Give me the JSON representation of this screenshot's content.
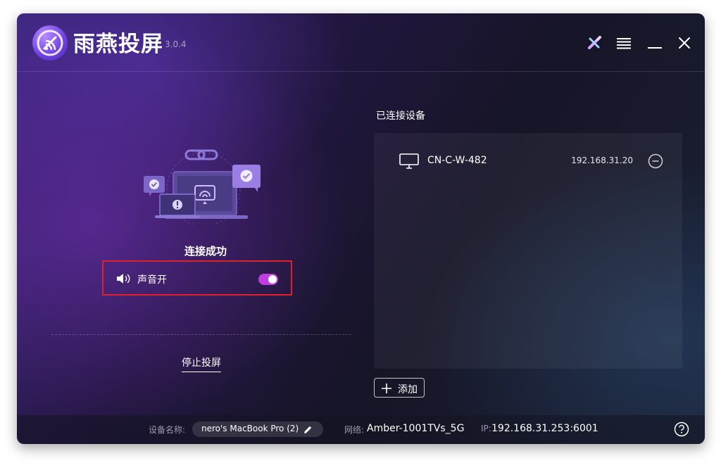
{
  "app": {
    "title": "雨燕投屏",
    "version": "3.0.4"
  },
  "titlebar": {
    "icons": [
      "cast-pencil-icon",
      "menu-icon",
      "minimize-icon",
      "close-icon"
    ]
  },
  "left": {
    "status": "连接成功",
    "sound": {
      "label": "声音开",
      "enabled": true,
      "icon": "speaker-icon"
    },
    "stop_label": "停止投屏"
  },
  "right": {
    "title": "已连接设备",
    "devices": [
      {
        "name": "CN-C-W-482",
        "ip": "192.168.31.20",
        "icon": "monitor-icon"
      }
    ],
    "add_label": "添加"
  },
  "statusbar": {
    "device_label": "设备名称:",
    "device_value": "nero's MacBook Pro (2)",
    "network_label": "网络:",
    "network_value": "Amber-1001TVs_5G",
    "ip_label": "IP:",
    "ip_value": "192.168.31.253:6001"
  },
  "colors": {
    "accent": "#c23de0",
    "highlight_border": "#e0202a"
  }
}
